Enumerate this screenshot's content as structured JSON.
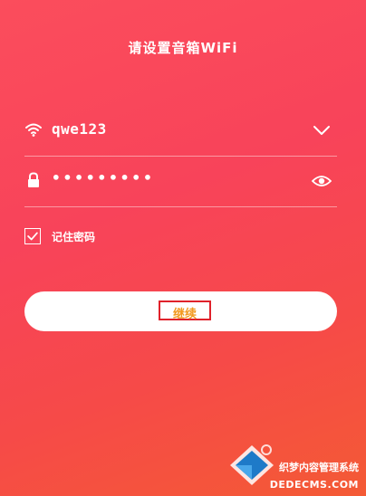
{
  "header": {
    "title": "请设置音箱WiFi"
  },
  "wifi": {
    "ssid": "qwe123",
    "icon": "wifi-icon",
    "dropdown_icon": "chevron-down-icon"
  },
  "password": {
    "masked_value": "•••••••••",
    "icon": "lock-icon",
    "toggle_icon": "eye-icon"
  },
  "remember": {
    "label": "记住密码",
    "checked": true
  },
  "continue_button": {
    "label": "继续"
  },
  "watermark": {
    "line1": "织梦内容管理系统",
    "line2": "DEDECMS.COM"
  },
  "colors": {
    "background_top": "#fb4d5c",
    "background_bottom": "#f45a35",
    "button_text": "#f29a20",
    "highlight_box": "#e0222b"
  }
}
